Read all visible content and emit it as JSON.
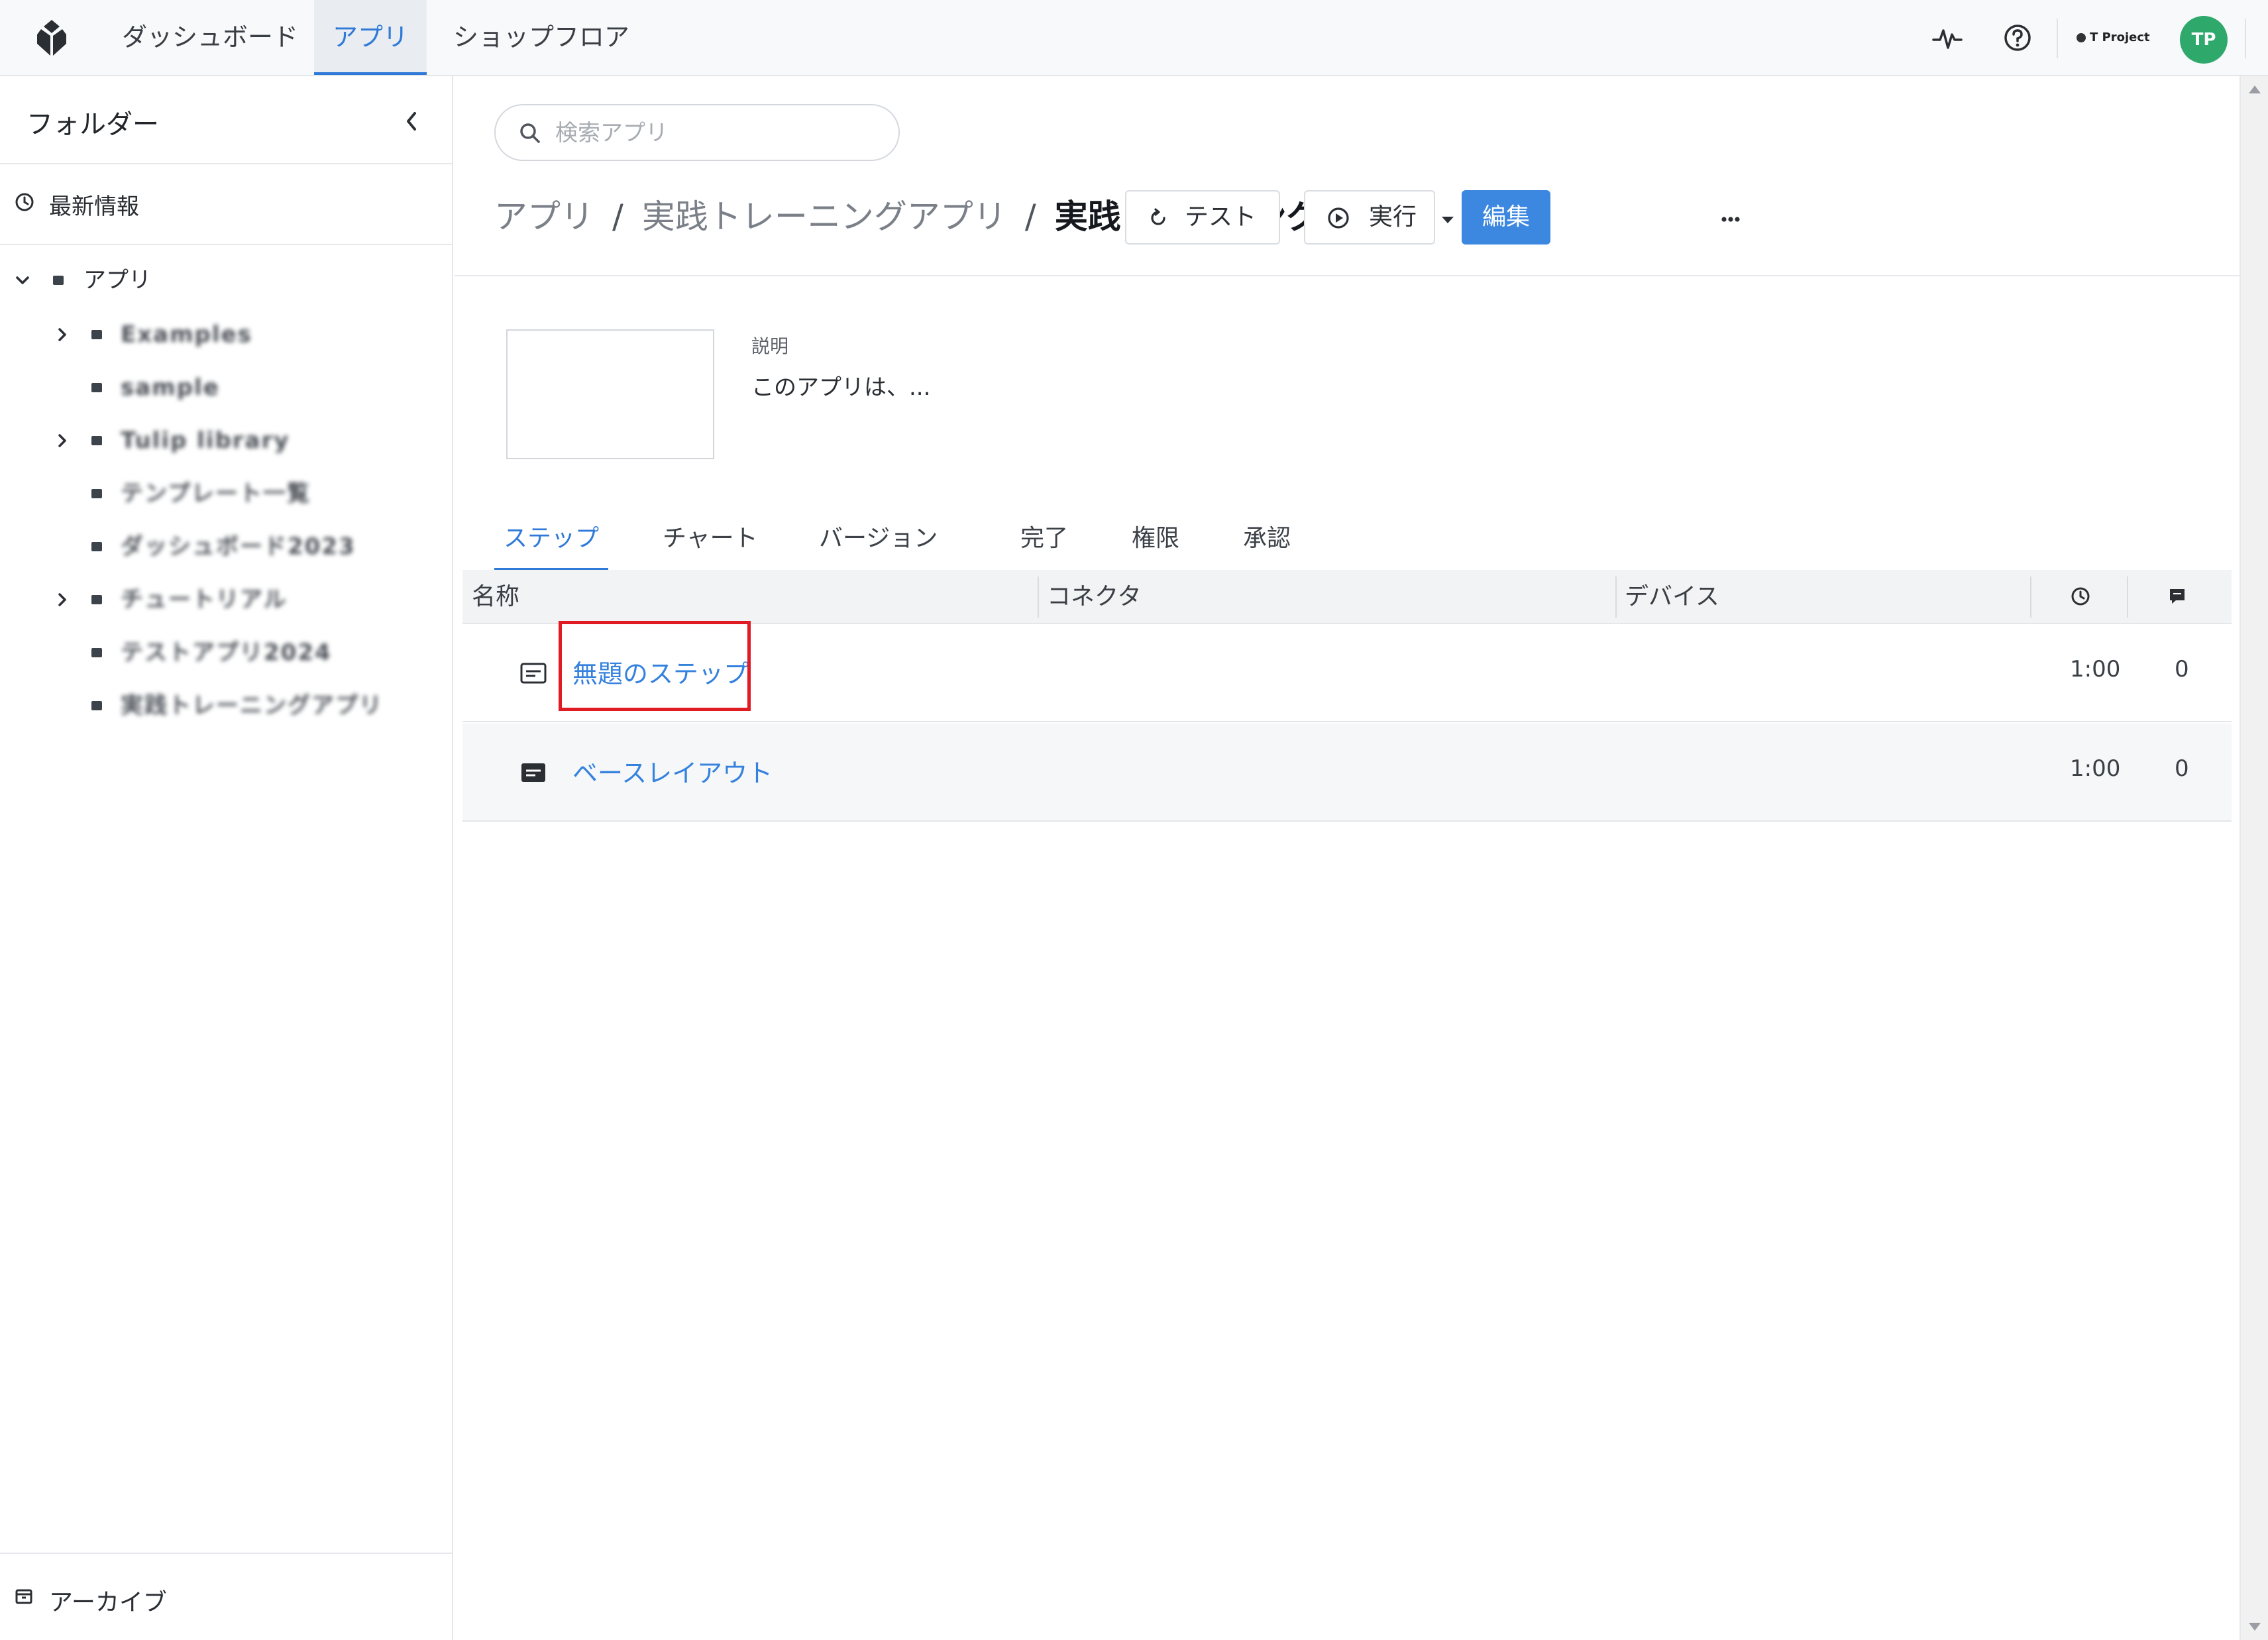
{
  "nav": {
    "tabs": [
      {
        "label": "ダッシュボード"
      },
      {
        "label": "アプリ"
      },
      {
        "label": "ショップフロア"
      }
    ],
    "active_tab": "アプリ",
    "project_label": "T Project",
    "avatar_initials": "TP",
    "accent_color": "#2f7ad8",
    "avatar_color": "#2ea96b"
  },
  "sidebar": {
    "title": "フォルダー",
    "recent_label": "最新情報",
    "root_folder": "アプリ",
    "items": [
      {
        "label": "Examples",
        "expandable": true
      },
      {
        "label": "sample",
        "expandable": false
      },
      {
        "label": "Tulip library",
        "expandable": true
      },
      {
        "label": "テンプレート一覧",
        "expandable": false
      },
      {
        "label": "ダッシュボード2023",
        "expandable": false
      },
      {
        "label": "チュートリアル",
        "expandable": true
      },
      {
        "label": "テストアプリ2024",
        "expandable": false
      },
      {
        "label": "実践トレーニングアプリ",
        "expandable": false
      }
    ],
    "archive_label": "アーカイブ"
  },
  "main": {
    "search_placeholder": "検索アプリ",
    "breadcrumb": {
      "root": "アプリ",
      "folder": "実践トレーニングアプリ",
      "current": "実践トレーニングアプリ"
    },
    "buttons": {
      "test": "テスト",
      "run": "実行",
      "edit": "編集"
    },
    "description_label": "説明",
    "description_text": "このアプリは、...",
    "tabs": [
      "ステップ",
      "チャート",
      "バージョン",
      "完了",
      "権限",
      "承認"
    ],
    "active_tab": "ステップ",
    "table": {
      "columns": [
        "名称",
        "コネクタ",
        "デバイス"
      ],
      "rows": [
        {
          "name": "無題のステップ",
          "time": "1:00",
          "comments": "0",
          "icon": "step-icon"
        },
        {
          "name": "ベースレイアウト",
          "time": "1:00",
          "comments": "0",
          "icon": "base-layout-icon"
        }
      ]
    }
  }
}
